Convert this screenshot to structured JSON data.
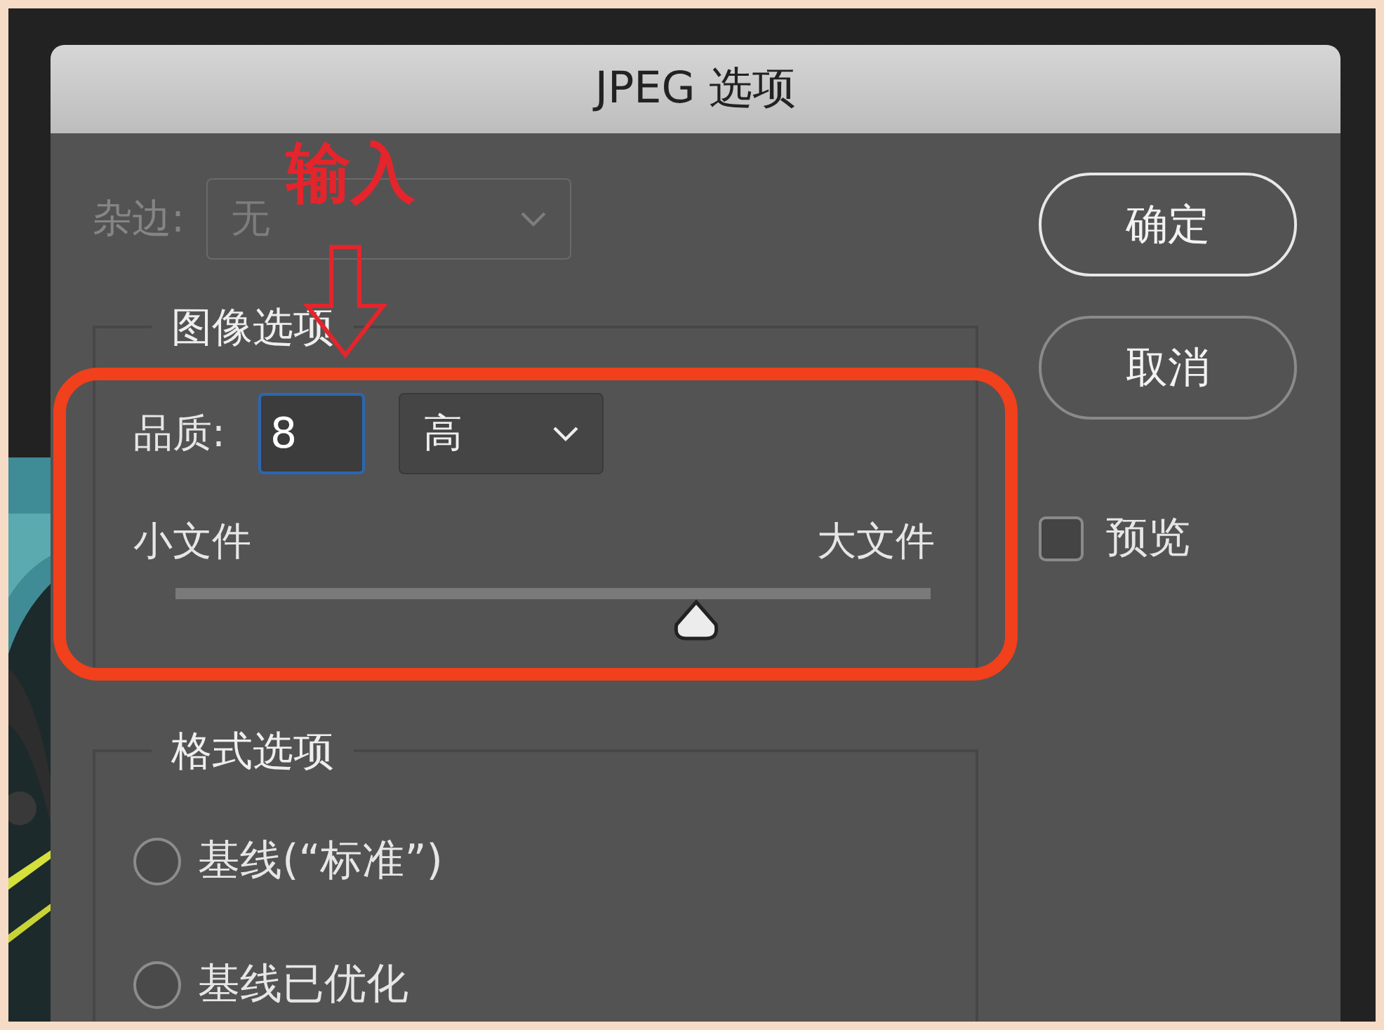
{
  "window": {
    "title": "JPEG 选项"
  },
  "matte": {
    "label": "杂边:",
    "value": "无",
    "disabled": true
  },
  "image_options": {
    "title": "图像选项",
    "quality": {
      "label": "品质:",
      "value": "8",
      "preset": "高"
    },
    "slider": {
      "min_label": "小文件",
      "max_label": "大文件",
      "level": 0.69
    }
  },
  "format_options": {
    "title": "格式选项",
    "options": [
      {
        "label": "基线(“标准”)",
        "selected": false
      },
      {
        "label": "基线已优化",
        "selected": false
      }
    ]
  },
  "buttons": [
    {
      "label": "确定",
      "default": true
    },
    {
      "label": "取消",
      "default": false
    }
  ],
  "preview": {
    "label": "预览",
    "checked": false
  },
  "annotation": {
    "label": "输入"
  }
}
